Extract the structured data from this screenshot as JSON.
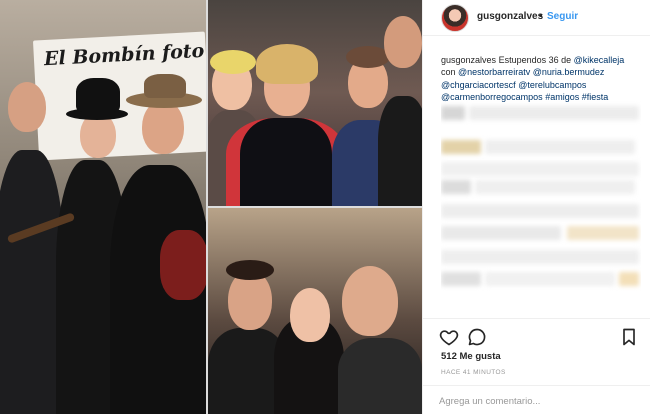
{
  "post": {
    "username": "gusgonzalves",
    "separator": "•",
    "follow_label": "Seguir"
  },
  "caption": {
    "username": "gusgonzalves",
    "text": "Estupendos 36 de",
    "mentions": [
      "@kikecalleja",
      "@nestorbarreiratv",
      "@nuria.bermudez",
      "@chgarciacortescf",
      "@terelubcampos",
      "@carmenborregocampos"
    ],
    "connector": "con",
    "hashtags": [
      "#amigos",
      "#fiesta"
    ]
  },
  "photo": {
    "banner_text": "El Bombín foto"
  },
  "actions": {
    "like_icon": "heart-icon",
    "comment_icon": "comment-bubble-icon",
    "save_icon": "bookmark-icon",
    "likes_text": "512 Me gusta",
    "time_text": "HACE 41 MINUTOS"
  },
  "comment_box": {
    "placeholder": "Agrega un comentario..."
  },
  "colors": {
    "link": "#003569",
    "follow": "#3897f0",
    "muted": "#999999",
    "border": "#efefef"
  }
}
